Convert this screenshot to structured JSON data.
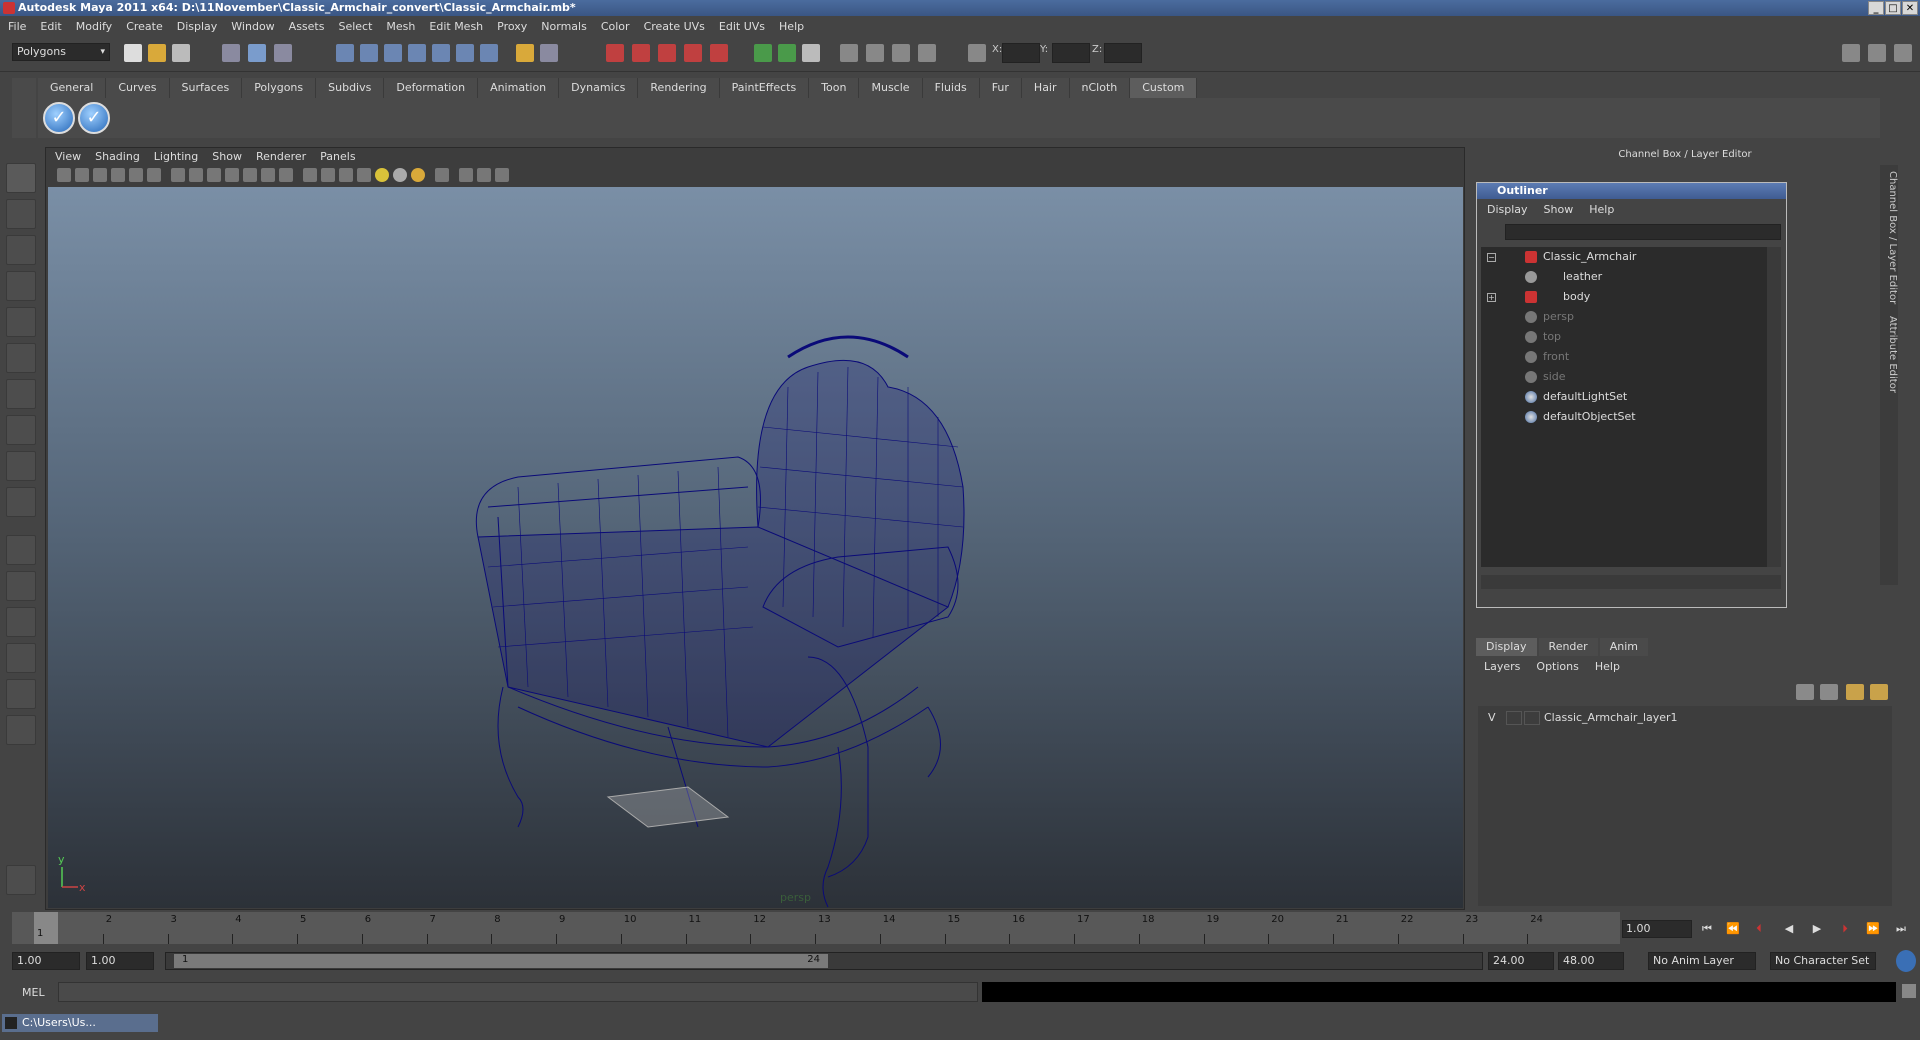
{
  "window": {
    "title": "Autodesk Maya 2011 x64: D:\\11November\\Classic_Armchair_convert\\Classic_Armchair.mb*"
  },
  "menubar": [
    "File",
    "Edit",
    "Modify",
    "Create",
    "Display",
    "Window",
    "Assets",
    "Select",
    "Mesh",
    "Edit Mesh",
    "Proxy",
    "Normals",
    "Color",
    "Create UVs",
    "Edit UVs",
    "Help"
  ],
  "statusline": {
    "mode": "Polygons",
    "x_label": "X:",
    "y_label": "Y:",
    "z_label": "Z:"
  },
  "shelf": {
    "tabs": [
      "General",
      "Curves",
      "Surfaces",
      "Polygons",
      "Subdivs",
      "Deformation",
      "Animation",
      "Dynamics",
      "Rendering",
      "PaintEffects",
      "Toon",
      "Muscle",
      "Fluids",
      "Fur",
      "Hair",
      "nCloth",
      "Custom"
    ],
    "active": "Custom"
  },
  "viewport": {
    "menu": [
      "View",
      "Shading",
      "Lighting",
      "Show",
      "Renderer",
      "Panels"
    ],
    "camera": "persp",
    "axis_x": "x",
    "axis_y": "y",
    "wire_color": "#0a0a78"
  },
  "channelbox": {
    "header": "Channel Box / Layer Editor",
    "side_tab_1": "Channel Box / Layer Editor",
    "side_tab_2": "Attribute Editor"
  },
  "outliner": {
    "title": "Outliner",
    "menu": [
      "Display",
      "Show",
      "Help"
    ],
    "items": [
      {
        "label": "Classic_Armchair",
        "dim": false
      },
      {
        "label": "leather",
        "dim": false
      },
      {
        "label": "body",
        "dim": false
      },
      {
        "label": "persp",
        "dim": true
      },
      {
        "label": "top",
        "dim": true
      },
      {
        "label": "front",
        "dim": true
      },
      {
        "label": "side",
        "dim": true
      },
      {
        "label": "defaultLightSet",
        "dim": false
      },
      {
        "label": "defaultObjectSet",
        "dim": false
      }
    ]
  },
  "layers": {
    "tabs": [
      "Display",
      "Render",
      "Anim"
    ],
    "active": "Display",
    "menu": [
      "Layers",
      "Options",
      "Help"
    ],
    "row": {
      "visible": "V",
      "name": "Classic_Armchair_layer1"
    }
  },
  "timeline": {
    "ticks": [
      "1",
      "2",
      "3",
      "4",
      "5",
      "6",
      "7",
      "8",
      "9",
      "10",
      "11",
      "12",
      "13",
      "14",
      "15",
      "16",
      "17",
      "18",
      "19",
      "20",
      "21",
      "22",
      "23",
      "24"
    ],
    "current_frame": "1.00",
    "current_marker": "1"
  },
  "range": {
    "start_a": "1.00",
    "start_b": "1.00",
    "slider_start": "1",
    "slider_end": "24",
    "end_a": "24.00",
    "end_b": "48.00",
    "anim_layer": "No Anim Layer",
    "char_set": "No Character Set"
  },
  "cmdline": {
    "label": "MEL"
  },
  "taskbar": {
    "label": "C:\\Users\\Us..."
  }
}
